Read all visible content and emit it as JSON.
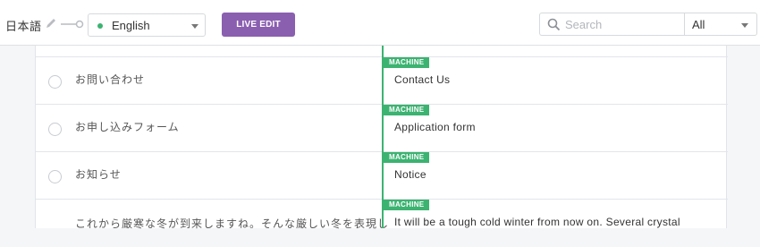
{
  "toolbar": {
    "source_language": "日本語",
    "target_language": "English",
    "target_status_color": "#3cb371",
    "live_edit_label": "LIVE EDIT",
    "search_placeholder": "Search",
    "filter_value": "All",
    "icons": [
      "pencil-icon",
      "link-icon",
      "search-icon",
      "chevron-down-icon"
    ]
  },
  "colors": {
    "accent": "#8a5fb0",
    "machine": "#3cb371"
  },
  "rows": [
    {
      "source": "お問い合わせ",
      "badge": "MACHINE",
      "target": "Contact Us"
    },
    {
      "source": "お申し込みフォーム",
      "badge": "MACHINE",
      "target": "Application form"
    },
    {
      "source": "お知らせ",
      "badge": "MACHINE",
      "target": "Notice"
    },
    {
      "source": "これから厳寒な冬が到来しますね。そんな厳しい冬を表現し",
      "badge": "MACHINE",
      "target": "It will be a tough cold winter from now on. Several crystal"
    }
  ]
}
